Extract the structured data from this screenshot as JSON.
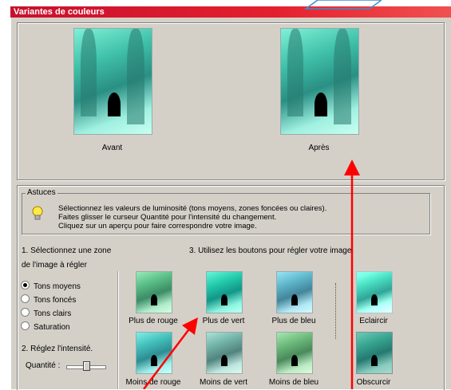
{
  "window": {
    "title": "Variantes de couleurs"
  },
  "preview": {
    "before_label": "Avant",
    "after_label": "Après"
  },
  "tips": {
    "legend": "Astuces",
    "lines": [
      "Sélectionnez les valeurs de luminosité (tons moyens, zones foncées ou claires).",
      "Faites glisser le curseur Quantité pour l'intensité du changement.",
      "Cliquez sur un aperçu pour faire correspondre votre image."
    ]
  },
  "step1": {
    "line1": "1. Sélectionnez une zone",
    "line2": "de l'image à régler"
  },
  "step3": {
    "label": "3. Utilisez les boutons pour régler votre image."
  },
  "zones": [
    {
      "label": "Tons moyens",
      "selected": true
    },
    {
      "label": "Tons foncés",
      "selected": false
    },
    {
      "label": "Tons clairs",
      "selected": false
    },
    {
      "label": "Saturation",
      "selected": false
    }
  ],
  "step2": {
    "label": "2. Réglez l'intensité.",
    "amount_label": "Quantité :",
    "amount_value": 0.5
  },
  "buttons": {
    "more_red": "Plus de rouge",
    "more_green": "Plus de vert",
    "more_blue": "Plus de bleu",
    "lighten": "Eclaircir",
    "less_red": "Moins de rouge",
    "less_green": "Moins de vert",
    "less_blue": "Moins de bleu",
    "darken": "Obscurcir"
  },
  "colors": {
    "title_bar": "#e0202e",
    "dialog_bg": "#d4d0c8",
    "annotation_arrow": "#ff0000"
  }
}
